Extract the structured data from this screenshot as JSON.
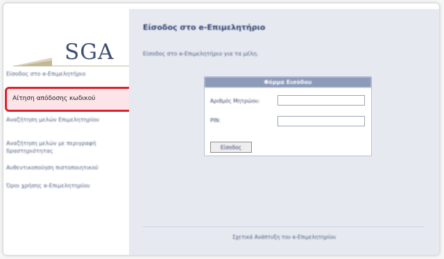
{
  "logo": {
    "text": "SGA"
  },
  "sidebar": {
    "items": [
      {
        "label": "Είσοδος στο e-Επιμελητήριο"
      },
      {
        "label": "Αίτηση απόδοσης κωδικού"
      },
      {
        "label": "Αναζήτηση μελών Επιμελητηρίου"
      },
      {
        "label": "Αναζήτηση μελών με περιγραφή δραστηριότητας"
      },
      {
        "label": "Αυθεντικοποίηση πιστοποιητικού"
      },
      {
        "label": "Όροι χρήσης e-Επιμελητηρίου"
      }
    ],
    "highlight_color": "#e01f2d"
  },
  "main": {
    "title": "Είσοδος στο e-Επιμελητήριο",
    "description": "Είσοδος στο e-Επιμελητήριο για τα μέλη.",
    "form": {
      "header": "Φόρμα Εισόδου",
      "member_label": "Αριθμός Μητρώου:",
      "member_value": "",
      "pin_label": "PIN:",
      "pin_value": "",
      "submit_label": "Είσοδος"
    },
    "footer": "Σχετικά Ανάπτυξη του e-Επιμελητηρίου"
  }
}
